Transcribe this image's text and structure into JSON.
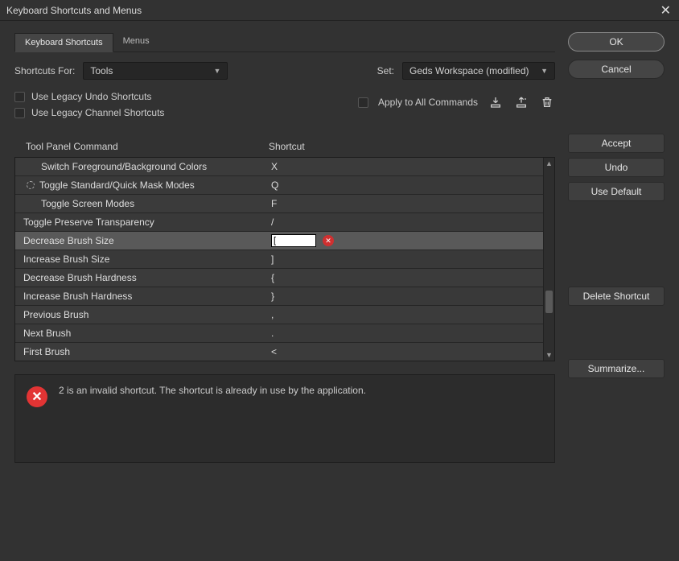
{
  "window": {
    "title": "Keyboard Shortcuts and Menus"
  },
  "tabs": {
    "shortcuts": "Keyboard Shortcuts",
    "menus": "Menus"
  },
  "shortcutsFor": {
    "label": "Shortcuts For:",
    "value": "Tools"
  },
  "set": {
    "label": "Set:",
    "value": "Geds Workspace (modified)"
  },
  "checks": {
    "legacyUndo": "Use Legacy Undo Shortcuts",
    "legacyChannel": "Use Legacy Channel Shortcuts",
    "applyAll": "Apply to All Commands"
  },
  "headers": {
    "command": "Tool Panel Command",
    "shortcut": "Shortcut"
  },
  "rows": [
    {
      "cmd": "Switch Foreground/Background Colors",
      "sc": "X",
      "icon": false
    },
    {
      "cmd": "Toggle Standard/Quick Mask Modes",
      "sc": "Q",
      "icon": true
    },
    {
      "cmd": "Toggle Screen Modes",
      "sc": "F",
      "icon": false
    },
    {
      "cmd": "Toggle Preserve Transparency",
      "sc": "/",
      "icon": false,
      "noindent": true
    },
    {
      "cmd": "Decrease Brush Size",
      "sc": "[",
      "icon": false,
      "noindent": true,
      "editing": true
    },
    {
      "cmd": "Increase Brush Size",
      "sc": "]",
      "icon": false,
      "noindent": true
    },
    {
      "cmd": "Decrease Brush Hardness",
      "sc": "{",
      "icon": false,
      "noindent": true
    },
    {
      "cmd": "Increase Brush Hardness",
      "sc": "}",
      "icon": false,
      "noindent": true
    },
    {
      "cmd": "Previous Brush",
      "sc": ",",
      "icon": false,
      "noindent": true
    },
    {
      "cmd": "Next Brush",
      "sc": ".",
      "icon": false,
      "noindent": true
    },
    {
      "cmd": "First Brush",
      "sc": "<",
      "icon": false,
      "noindent": true
    }
  ],
  "error": {
    "text": "2 is an invalid shortcut.  The shortcut is already in use by the application."
  },
  "buttons": {
    "ok": "OK",
    "cancel": "Cancel",
    "accept": "Accept",
    "undo": "Undo",
    "useDefault": "Use Default",
    "deleteShortcut": "Delete Shortcut",
    "summarize": "Summarize..."
  }
}
